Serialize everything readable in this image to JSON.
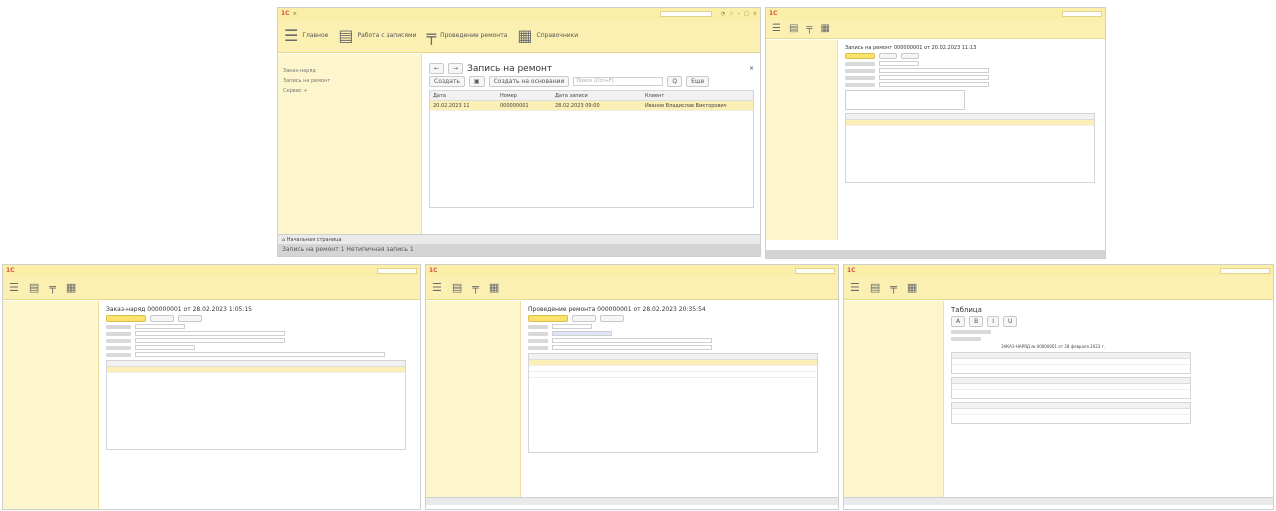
{
  "windows": {
    "w1": {
      "nav": {
        "item1": "Главное",
        "item2": "Работа с записями",
        "item3": "Проведение ремонта",
        "item4": "Справочники"
      },
      "side": {
        "item1": "Заказ-наряд",
        "item2": "Запись на ремонт",
        "more": "Сервис +"
      },
      "main": {
        "title": "Запись на ремонт",
        "create_button": "Создать",
        "create_based": "Создать на основании",
        "search_placeholder": "Поиск (Ctrl+F)",
        "more_button": "Еще",
        "columns": [
          "Дата",
          "Номер",
          "Дата записи",
          "Клиент"
        ],
        "row": [
          "20.02.2023 11",
          "000000001",
          "28.02.2023 09:00",
          "Иванов Владислав Викторович"
        ]
      },
      "statusbar": {
        "tab": "Начальная страница",
        "secondary": "Запись на ремонт 1  Нетипичная запись 1"
      }
    },
    "w2": {
      "title": "Запись на ремонт 000000001 от 20.02.2023 11:13"
    },
    "w3": {
      "title": "Заказ-наряд 000000001 от 28.02.2023 1:05:15"
    },
    "w4": {
      "title": "Проведение ремонта 000000001 от 28.02.2023 20:35:54"
    },
    "w5": {
      "title": "Таблица",
      "report_title": "ЗАКАЗ-НАРЯД № 00000001 от 28 февраля 2023 г."
    }
  }
}
